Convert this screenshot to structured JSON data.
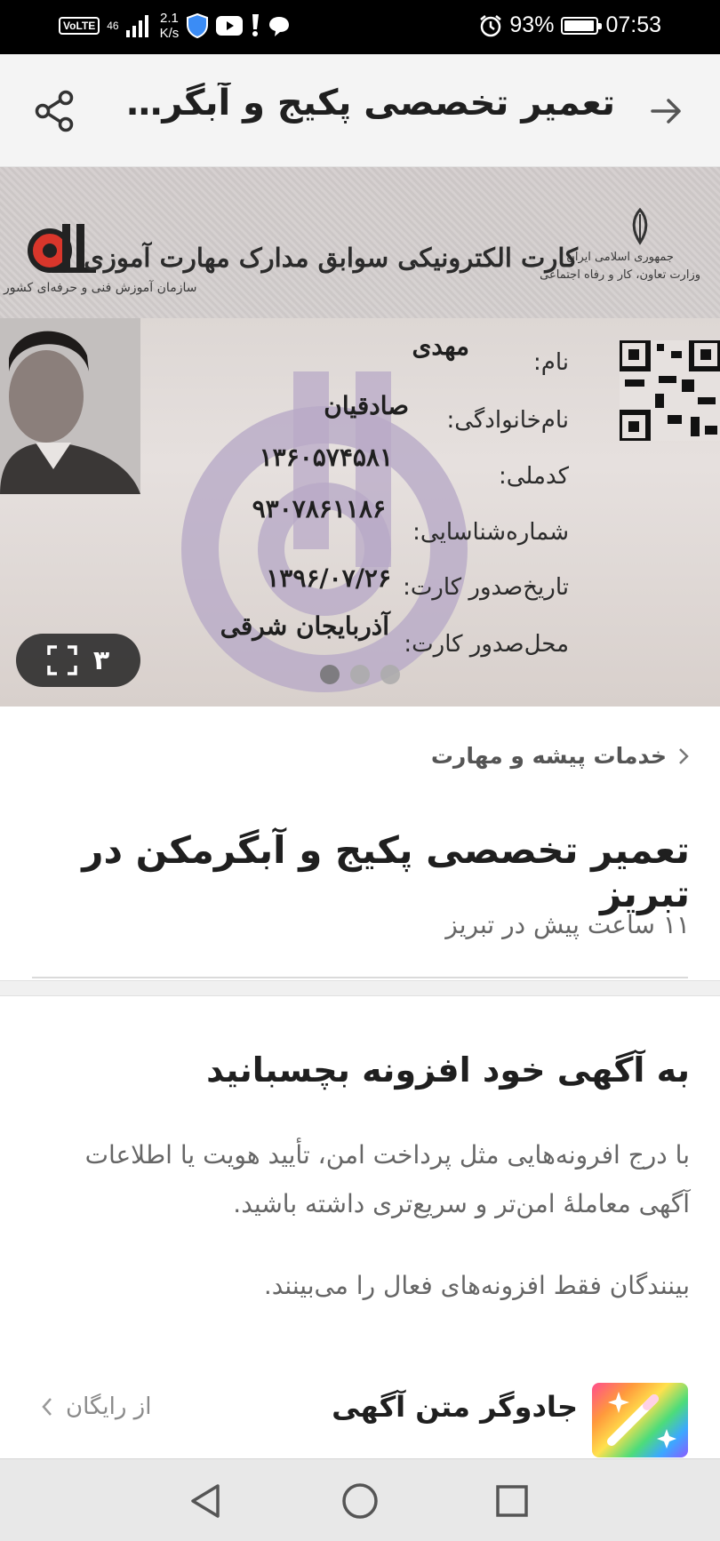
{
  "status_bar": {
    "volte": "VoLTE",
    "network": "46",
    "speed": "2.1",
    "speed_unit": "K/s",
    "battery": "93%",
    "time": "07:53",
    "icons": [
      "signal-icon",
      "vpn-shield-icon",
      "youtube-icon",
      "alert-icon",
      "chat-icon",
      "alarm-icon",
      "battery-icon"
    ]
  },
  "header": {
    "title": "تعمیر تخصصی پکیج و آبگرمکن د...",
    "back_icon": "arrow-right-icon",
    "share_icon": "share-icon"
  },
  "gallery": {
    "counter": "۳",
    "expand_icon": "fullscreen-icon",
    "current_index": 1,
    "total_images": 3,
    "card": {
      "heading": "کارت الکترونیکی سوابق مدارک مهارت آموزی",
      "issuer_line1": "جمهوری اسلامی ایران",
      "issuer_line2": "وزارت تعاون، کار و رفاه اجتماعی",
      "org": "سازمان آموزش فنی و حرفه‌ای کشور",
      "fields": [
        {
          "label": "نام:",
          "value": "مهدی"
        },
        {
          "label": "نام‌خانوادگی:",
          "value": "صادقیان"
        },
        {
          "label": "کدملی:",
          "value": "۱۳۶۰۵۷۴۵۸۱"
        },
        {
          "label": "شماره‌شناسایی:",
          "value": "۹۳۰۷۸۶۱۱۸۶"
        },
        {
          "label": "تاریخ‌صدور کارت:",
          "value": "۱۳۹۶/۰۷/۲۶"
        },
        {
          "label": "محل‌صدور کارت:",
          "value": "آذربایجان شرقی"
        }
      ]
    }
  },
  "breadcrumb": {
    "label": "خدمات پیشه و مهارت"
  },
  "ad": {
    "title": "تعمیر تخصصی پکیج و آبگرمکن در تبریز",
    "meta": "۱۱ ساعت پیش در تبریز"
  },
  "addons": {
    "title": "به آگهی خود افزونه بچسبانید",
    "description": "با درج افرونه‌هایی مثل پرداخت امن، تأیید هویت یا اطلاعات آگهی معاملهٔ امن‌تر و سریع‌تری داشته باشید.",
    "note": "بینندگان فقط افزونه‌های فعال را می‌بینند.",
    "feature": {
      "title": "جادوگر متن آگهی",
      "price": "از رایگان",
      "icon": "magic-wand-icon"
    }
  },
  "navbar": {
    "icons": [
      "back-triangle-icon",
      "home-circle-icon",
      "recents-square-icon"
    ]
  },
  "colors": {
    "status_bar_bg": "#000000",
    "header_bg": "#f4f4f4",
    "text_primary": "#1f1f1f",
    "text_secondary": "#666666",
    "navbar_bg": "#e8e8e8"
  }
}
